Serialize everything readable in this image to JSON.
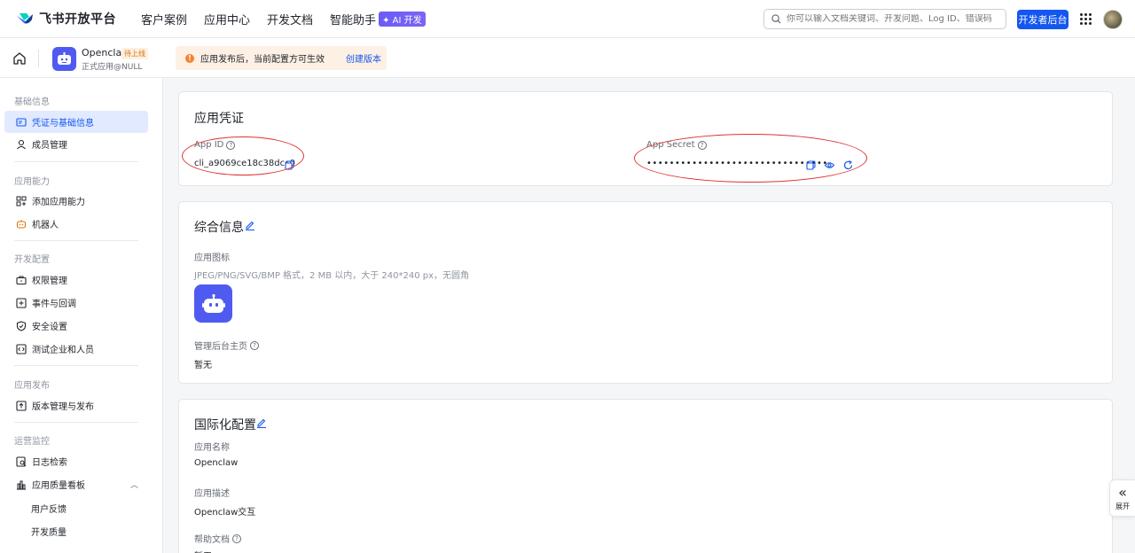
{
  "brand": {
    "name": "飞书开放平台"
  },
  "nav": [
    "客户案例",
    "应用中心",
    "开发文档",
    "智能助手"
  ],
  "ai_badge": "✦ AI 开发",
  "search": {
    "placeholder": "你可以输入文档关键词、开发问题、Log ID、错误码"
  },
  "dev_button": "开发者后台",
  "app": {
    "name": "Openclaw",
    "status": "待上线",
    "subtitle": "正式应用@NULL"
  },
  "notice": {
    "icon": "!",
    "text": "应用发布后，当前配置方可生效",
    "link": "创建版本"
  },
  "sidebar": {
    "groups": {
      "basic": "基础信息",
      "ability": "应用能力",
      "dev": "开发配置",
      "release": "应用发布",
      "ops": "运营监控"
    },
    "items": {
      "credentials": "凭证与基础信息",
      "members": "成员管理",
      "add_ability": "添加应用能力",
      "bot": "机器人",
      "permissions": "权限管理",
      "events": "事件与回调",
      "security": "安全设置",
      "test_org": "测试企业和人员",
      "versions": "版本管理与发布",
      "logs": "日志检索",
      "quality": "应用质量看板",
      "feedback": "用户反馈",
      "dev_quality": "开发质量"
    },
    "collapse_chevron": "︿"
  },
  "credentials": {
    "title": "应用凭证",
    "app_id_label": "App ID",
    "app_id": "cli_a9069ce18c38dcc0",
    "secret_label": "App Secret",
    "secret_mask": "••••••••••••••••••••••••••••••••"
  },
  "general": {
    "title": "综合信息",
    "icon_label": "应用图标",
    "icon_hint": "JPEG/PNG/SVG/BMP 格式，2 MB 以内，大于 240*240 px，无圆角",
    "admin_label": "管理后台主页",
    "admin_value": "暂无"
  },
  "i18n": {
    "title": "国际化配置",
    "name_label": "应用名称",
    "name_value": "Openclaw",
    "desc_label": "应用描述",
    "desc_value": "Openclaw交互",
    "help_label": "帮助文档",
    "help_value": "暂无"
  },
  "expand": {
    "arrow": "«",
    "label": "展开"
  },
  "help_glyph": "?",
  "colors": {
    "primary": "#1456f0",
    "accent_purple": "#4f5bf0",
    "annotation_red": "#e03131",
    "warning": "#f58231"
  }
}
